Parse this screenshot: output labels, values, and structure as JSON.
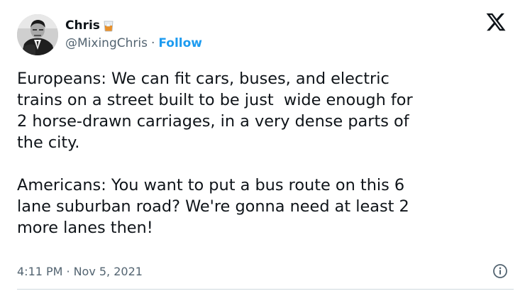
{
  "author": {
    "display_name": "Chris",
    "badge_icon": "whiskey-glass-icon",
    "handle": "@MixingChris",
    "separator": "·",
    "follow_label": "Follow"
  },
  "brand_icon": "x-logo-icon",
  "tweet": {
    "text": "Europeans: We can fit cars, buses, and electric\ntrains on a street built to be just  wide enough for\n2 horse-drawn carriages, in a very dense parts of\nthe city.\n\nAmericans: You want to put a bus route on this 6\nlane suburban road? We're gonna need at least 2\nmore lanes then!"
  },
  "meta": {
    "time": "4:11 PM",
    "separator": "·",
    "date": "Nov 5, 2021",
    "info_icon": "info-circle-icon"
  },
  "colors": {
    "text": "#0f1419",
    "secondary": "#536471",
    "accent": "#1d9bf0",
    "border": "#cfd9de"
  }
}
